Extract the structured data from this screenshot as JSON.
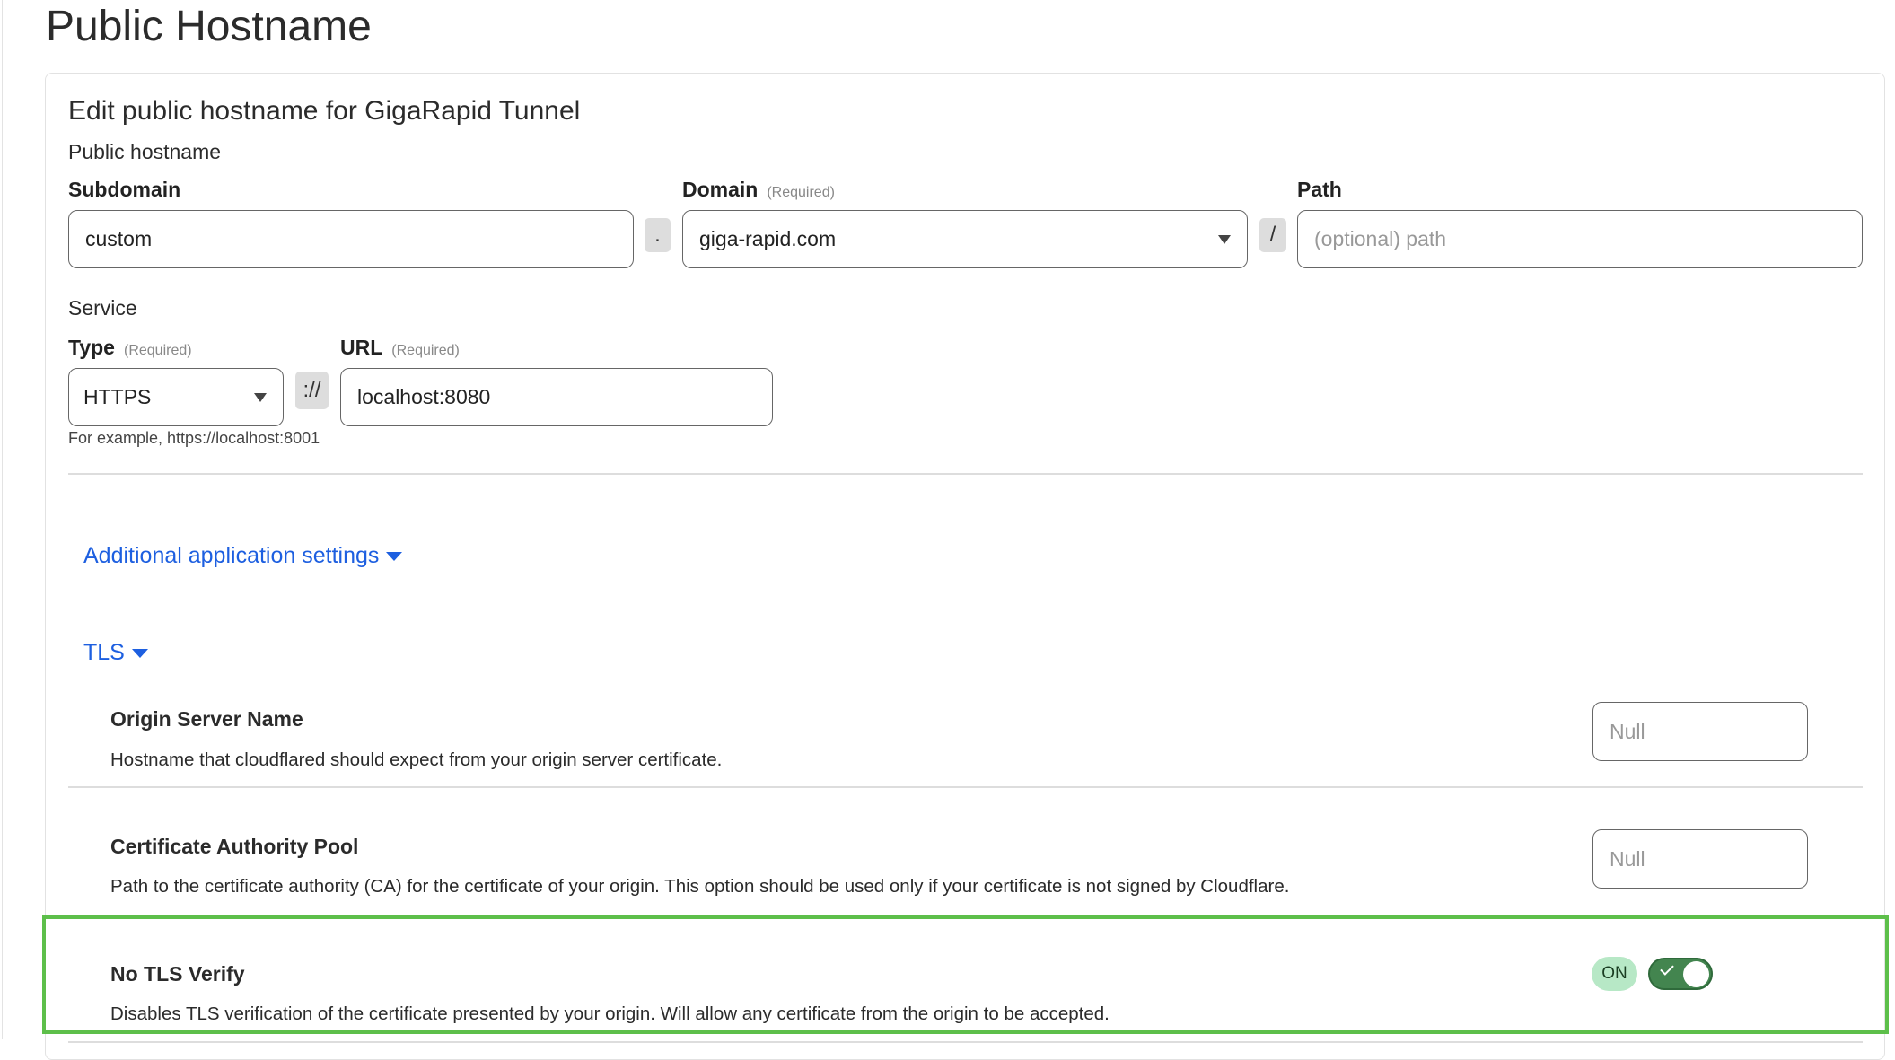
{
  "page_title": "Public Hostname",
  "form": {
    "heading": "Edit public hostname for GigaRapid Tunnel",
    "public_hostname_section": "Public hostname",
    "subdomain": {
      "label": "Subdomain",
      "value": "custom"
    },
    "dot_separator": ".",
    "domain": {
      "label": "Domain",
      "required": "(Required)",
      "value": "giga-rapid.com"
    },
    "slash_separator": "/",
    "path": {
      "label": "Path",
      "placeholder": "(optional) path"
    },
    "service_section": "Service",
    "type": {
      "label": "Type",
      "required": "(Required)",
      "value": "HTTPS"
    },
    "scheme_separator": "://",
    "url": {
      "label": "URL",
      "required": "(Required)",
      "value": "localhost:8080"
    },
    "hint": "For example, https://localhost:8001",
    "additional_settings": "Additional application settings",
    "tls_toggle": "TLS",
    "tls": {
      "origin_server_name": {
        "title": "Origin Server Name",
        "description": "Hostname that cloudflared should expect from your origin server certificate.",
        "placeholder": "Null"
      },
      "ca_pool": {
        "title": "Certificate Authority Pool",
        "description": "Path to the certificate authority (CA) for the certificate of your origin. This option should be used only if your certificate is not signed by Cloudflare.",
        "placeholder": "Null"
      },
      "no_tls_verify": {
        "title": "No TLS Verify",
        "description": "Disables TLS verification of the certificate presented by your origin. Will allow any certificate from the origin to be accepted.",
        "state": "ON",
        "enabled": true
      }
    }
  },
  "colors": {
    "link": "#1d5fe0",
    "toggle_on": "#43854f",
    "highlight": "#5dbf4a",
    "badge": "#b7e8c6"
  }
}
